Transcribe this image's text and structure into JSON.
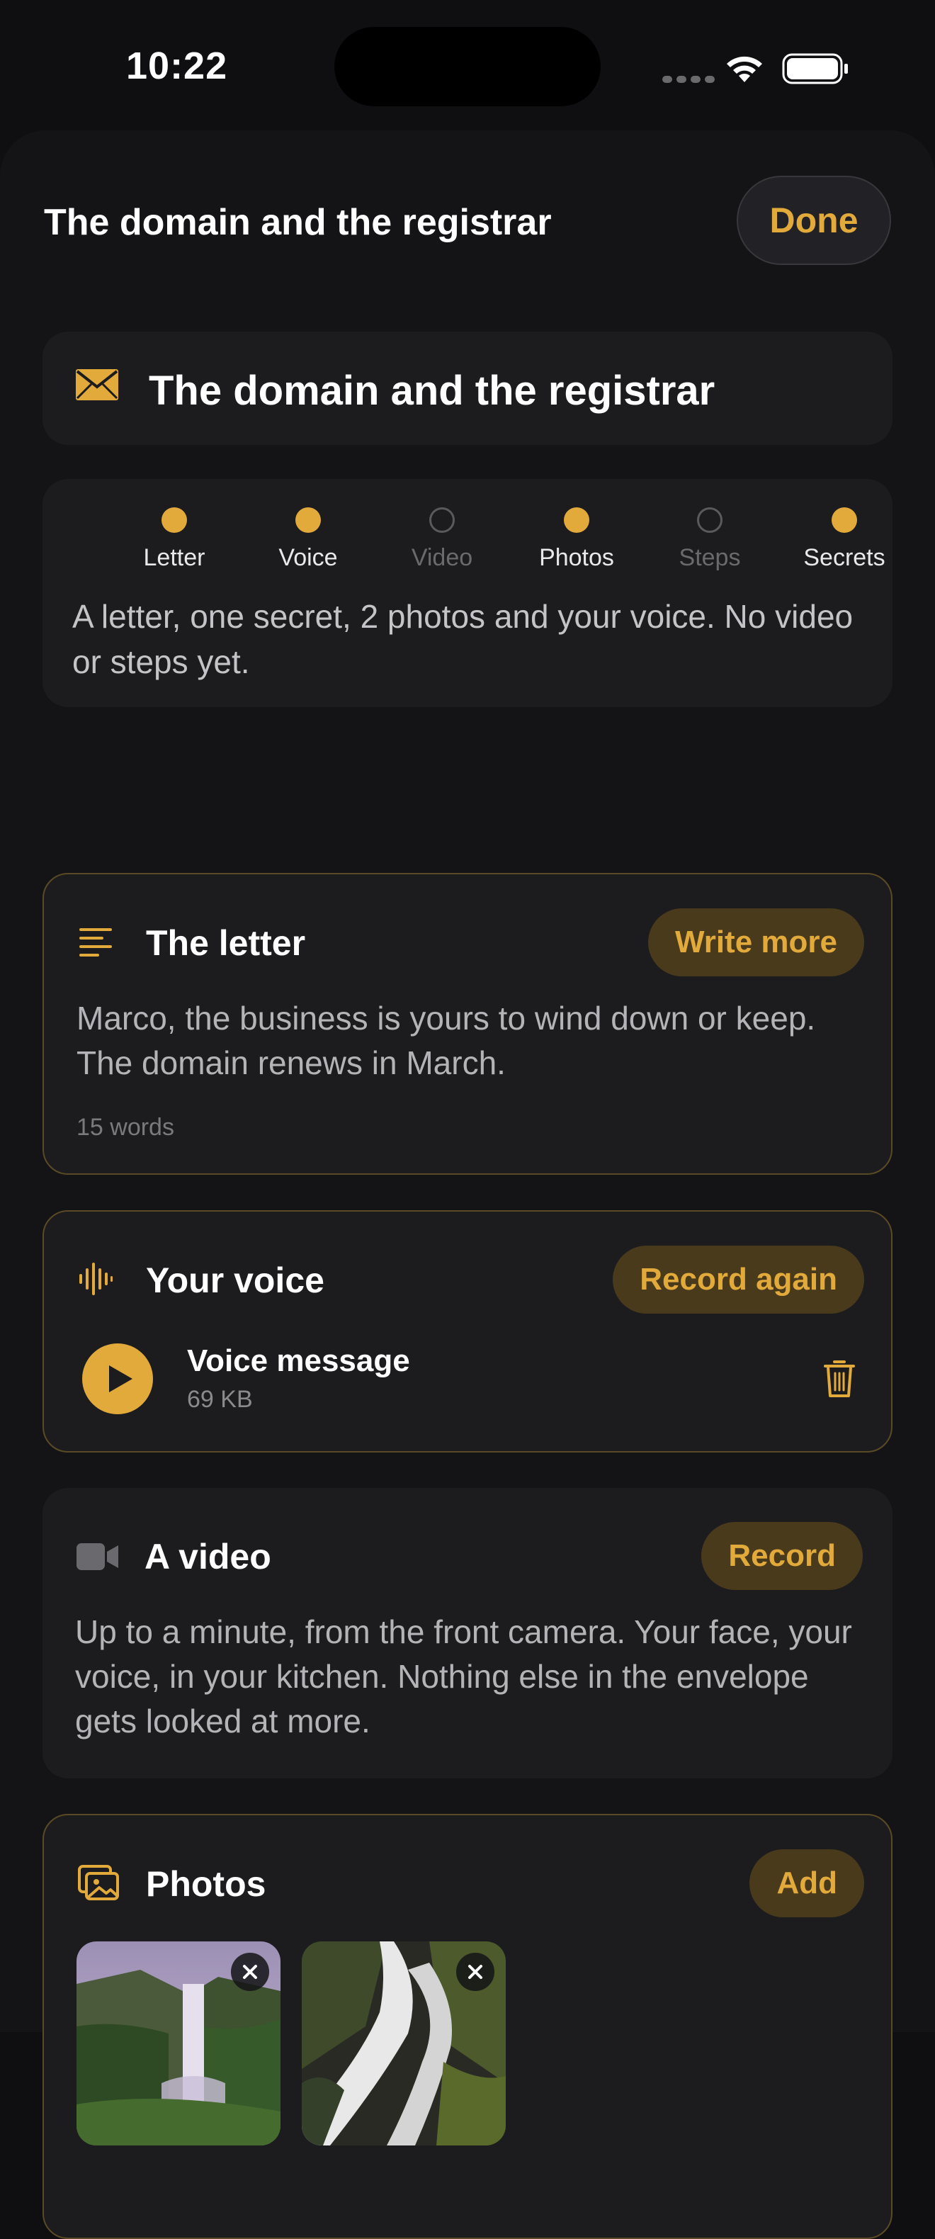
{
  "status_bar": {
    "time": "10:22"
  },
  "header": {
    "title": "The domain and the registrar",
    "done_label": "Done"
  },
  "title_card": {
    "title": "The domain and the registrar"
  },
  "status": {
    "items": [
      {
        "label": "Letter",
        "filled": true
      },
      {
        "label": "Voice",
        "filled": true
      },
      {
        "label": "Video",
        "filled": false
      },
      {
        "label": "Photos",
        "filled": true
      },
      {
        "label": "Steps",
        "filled": false
      },
      {
        "label": "Secrets",
        "filled": true
      }
    ],
    "summary": "A letter, one secret, 2 photos and your voice. No video or steps yet."
  },
  "letter": {
    "title": "The letter",
    "action": "Write more",
    "text": "Marco, the business is yours to wind down or keep. The domain renews in March.",
    "word_count": "15 words"
  },
  "voice": {
    "title": "Your voice",
    "action": "Record again",
    "message_title": "Voice message",
    "message_size": "69 KB"
  },
  "video": {
    "title": "A video",
    "action": "Record",
    "text": "Up to a minute, from the front camera. Your face, your voice, in your kitchen. Nothing else in the envelope gets looked at more."
  },
  "photos": {
    "title": "Photos",
    "action": "Add",
    "items": [
      {
        "icon": "waterfall-photo-1"
      },
      {
        "icon": "waterfall-photo-2"
      }
    ]
  },
  "colors": {
    "accent": "#e2a93b",
    "pill_bg": "#4a3a1c",
    "card_bg": "#1c1c1f",
    "sheet_bg": "#141416"
  }
}
